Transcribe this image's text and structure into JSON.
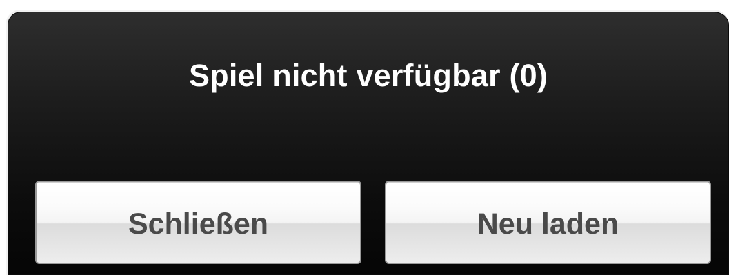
{
  "dialog": {
    "title": "Spiel nicht verfügbar (0)",
    "buttons": {
      "close_label": "Schließen",
      "reload_label": "Neu laden"
    }
  },
  "colors": {
    "dialog_background": "#1c1c1c",
    "title_text": "#ffffff",
    "button_text": "#4a4a4a",
    "button_face": "#f4f4f4"
  }
}
